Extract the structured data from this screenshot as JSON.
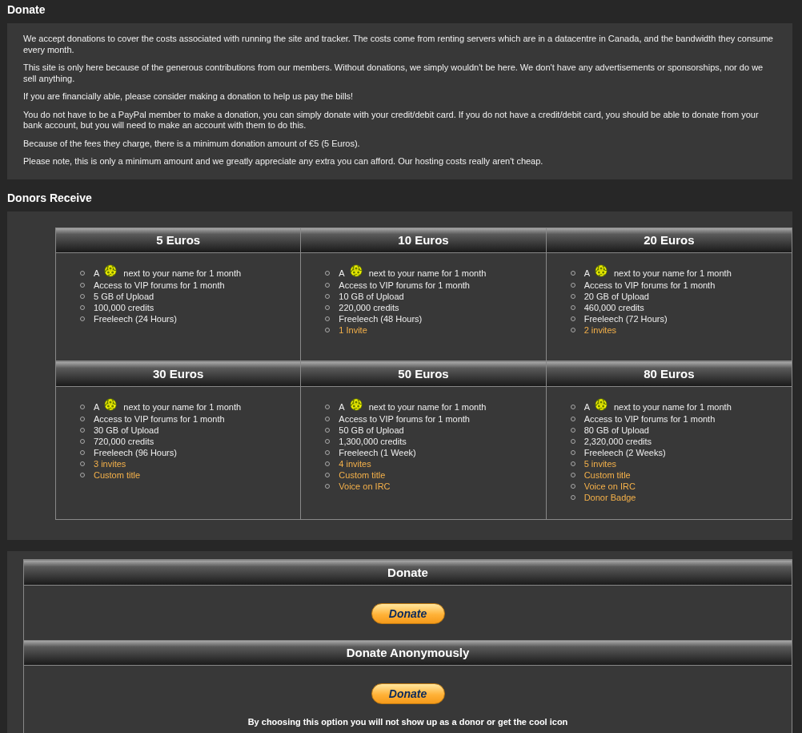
{
  "donate_section": {
    "title": "Donate",
    "paragraphs": [
      "We accept donations to cover the costs associated with running the site and tracker. The costs come from renting servers which are in a datacentre in Canada, and the bandwidth they consume every month.",
      "This site is only here because of the generous contributions from our members. Without donations, we simply wouldn't be here. We don't have any advertisements or sponsorships, nor do we sell anything.",
      "If you are financially able, please consider making a donation to help us pay the bills!",
      "You do not have to be a PayPal member to make a donation, you can simply donate with your credit/debit card. If you do not have a credit/debit card, you should be able to donate from your bank account, but you will need to make an account with them to do this.",
      "Because of the fees they charge, there is a minimum donation amount of €5 (5 Euros).",
      "Please note, this is only a minimum amount and we greatly appreciate any extra you can afford. Our hosting costs really aren't cheap."
    ]
  },
  "donors_receive": {
    "title": "Donors Receive",
    "tiers": [
      {
        "title": "5 Euros",
        "perks": [
          {
            "kind": "icon",
            "before": "A",
            "after": "next to your name for 1 month"
          },
          {
            "kind": "normal",
            "text": "Access to VIP forums for 1 month"
          },
          {
            "kind": "normal",
            "text": "5 GB of Upload"
          },
          {
            "kind": "normal",
            "text": "100,000 credits"
          },
          {
            "kind": "normal",
            "text": "Freeleech (24 Hours)"
          }
        ]
      },
      {
        "title": "10 Euros",
        "perks": [
          {
            "kind": "icon",
            "before": "A",
            "after": "next to your name for 1 month"
          },
          {
            "kind": "normal",
            "text": "Access to VIP forums for 1 month"
          },
          {
            "kind": "normal",
            "text": "10 GB of Upload"
          },
          {
            "kind": "normal",
            "text": "220,000 credits"
          },
          {
            "kind": "normal",
            "text": "Freeleech (48 Hours)"
          },
          {
            "kind": "extra",
            "text": "1 Invite"
          }
        ]
      },
      {
        "title": "20 Euros",
        "perks": [
          {
            "kind": "icon",
            "before": "A",
            "after": "next to your name for 1 month"
          },
          {
            "kind": "normal",
            "text": "Access to VIP forums for 1 month"
          },
          {
            "kind": "normal",
            "text": "20 GB of Upload"
          },
          {
            "kind": "normal",
            "text": "460,000 credits"
          },
          {
            "kind": "normal",
            "text": "Freeleech (72 Hours)"
          },
          {
            "kind": "extra",
            "text": "2 invites"
          }
        ]
      },
      {
        "title": "30 Euros",
        "perks": [
          {
            "kind": "icon",
            "before": "A",
            "after": "next to your name for 1 month"
          },
          {
            "kind": "normal",
            "text": "Access to VIP forums for 1 month"
          },
          {
            "kind": "normal",
            "text": "30 GB of Upload"
          },
          {
            "kind": "normal",
            "text": "720,000 credits"
          },
          {
            "kind": "normal",
            "text": "Freeleech (96 Hours)"
          },
          {
            "kind": "extra",
            "text": "3 invites"
          },
          {
            "kind": "extra",
            "text": "Custom title"
          }
        ]
      },
      {
        "title": "50 Euros",
        "perks": [
          {
            "kind": "icon",
            "before": "A",
            "after": "next to your name for 1 month"
          },
          {
            "kind": "normal",
            "text": "Access to VIP forums for 1 month"
          },
          {
            "kind": "normal",
            "text": "50 GB of Upload"
          },
          {
            "kind": "normal",
            "text": "1,300,000 credits"
          },
          {
            "kind": "normal",
            "text": "Freeleech (1 Week)"
          },
          {
            "kind": "extra",
            "text": "4 invites"
          },
          {
            "kind": "extra",
            "text": "Custom title"
          },
          {
            "kind": "extra",
            "text": "Voice on IRC"
          }
        ]
      },
      {
        "title": "80 Euros",
        "perks": [
          {
            "kind": "icon",
            "before": "A",
            "after": "next to your name for 1 month"
          },
          {
            "kind": "normal",
            "text": "Access to VIP forums for 1 month"
          },
          {
            "kind": "normal",
            "text": "80 GB of Upload"
          },
          {
            "kind": "normal",
            "text": "2,320,000 credits"
          },
          {
            "kind": "normal",
            "text": "Freeleech (2 Weeks)"
          },
          {
            "kind": "extra",
            "text": "5 invites"
          },
          {
            "kind": "extra",
            "text": "Custom title"
          },
          {
            "kind": "extra",
            "text": "Voice on IRC"
          },
          {
            "kind": "extra",
            "text": "Donor Badge"
          }
        ]
      }
    ]
  },
  "donate_options": [
    {
      "title": "Donate",
      "button": "Donate"
    },
    {
      "title": "Donate Anonymously",
      "button": "Donate",
      "note": "By choosing this option you will not show up as a donor or get the cool icon"
    }
  ]
}
